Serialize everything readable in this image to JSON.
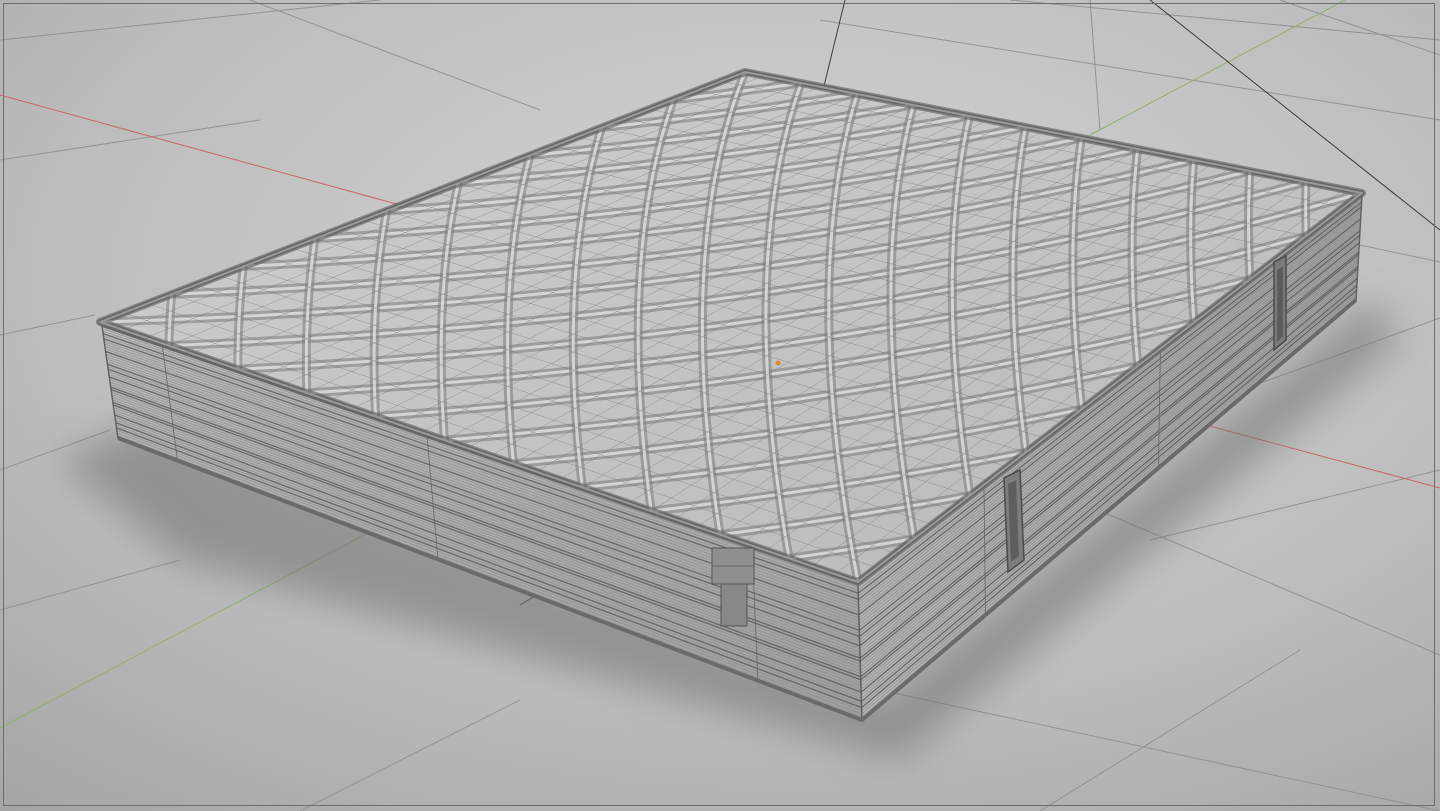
{
  "viewport": {
    "mode": "3d-viewport-wireframe-overlay",
    "colors": {
      "floor_light": "#c8c8c8",
      "floor_dark": "#9a9a9a",
      "grid_line": "#8c8c8c",
      "axis_x": "#c86a6a",
      "axis_y": "#8aae6a",
      "mesh_top": "#c4c4c4",
      "mesh_side": "#aeaeae",
      "mesh_edge": "#5f5f5f",
      "wire": "#444444",
      "origin_point": "#e08a2a"
    }
  },
  "scene": {
    "object": "mattress-mesh",
    "handles": [
      "handle-front-left",
      "handle-front-right",
      "handle-right-side"
    ]
  }
}
